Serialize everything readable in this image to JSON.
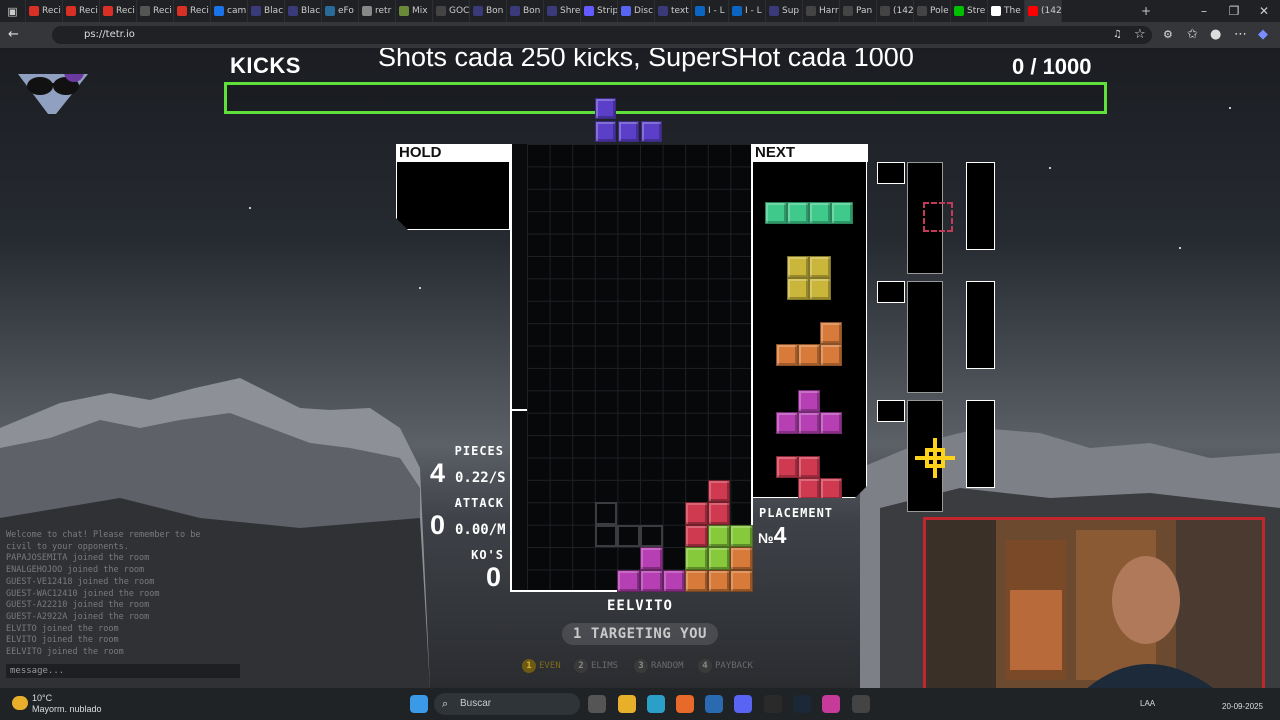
{
  "browser": {
    "tabs": [
      {
        "label": "Reci",
        "color": "#d93025"
      },
      {
        "label": "Reci",
        "color": "#d93025"
      },
      {
        "label": "Reci",
        "color": "#d93025"
      },
      {
        "label": "Reci",
        "color": "#555555"
      },
      {
        "label": "Reci",
        "color": "#d93025"
      },
      {
        "label": "cam",
        "color": "#1a73e8"
      },
      {
        "label": "Blac",
        "color": "#3a3a7a"
      },
      {
        "label": "Blac",
        "color": "#3a3a7a"
      },
      {
        "label": "eFo",
        "color": "#2a6a9a"
      },
      {
        "label": "retr",
        "color": "#888888"
      },
      {
        "label": "Mix",
        "color": "#6a8a3a"
      },
      {
        "label": "GOC",
        "color": "#444444"
      },
      {
        "label": "Bon",
        "color": "#3a3a7a"
      },
      {
        "label": "Bon",
        "color": "#3a3a7a"
      },
      {
        "label": "Shre",
        "color": "#3a3a7a"
      },
      {
        "label": "Strip",
        "color": "#635bff"
      },
      {
        "label": "Disc",
        "color": "#5865f2"
      },
      {
        "label": "text",
        "color": "#3a3a7a"
      },
      {
        "label": "I - L",
        "color": "#0a66c2"
      },
      {
        "label": "I - L",
        "color": "#0a66c2"
      },
      {
        "label": "Sup",
        "color": "#3a3a7a"
      },
      {
        "label": "Harr",
        "color": "#444444"
      },
      {
        "label": "Pan",
        "color": "#444444"
      },
      {
        "label": "(142",
        "color": "#444444"
      },
      {
        "label": "Pole",
        "color": "#444444"
      },
      {
        "label": "Stre",
        "color": "#00c000"
      },
      {
        "label": "The",
        "color": "#ffffff"
      },
      {
        "label": "(142",
        "color": "#ff0000"
      }
    ],
    "url": "ps://tetr.io"
  },
  "hud": {
    "kicks_label": "KICKS",
    "goal_text": "Shots cada 250 kicks, SuperSHot cada 1000",
    "counter": "0  / 1000",
    "progress_fraction": 0,
    "bar_color": "#5fe03a"
  },
  "panels": {
    "hold_title": "HOLD",
    "next_title": "NEXT",
    "next_queue": [
      "I",
      "O",
      "L",
      "T",
      "Z"
    ]
  },
  "piece_colors": {
    "I": "#3fc98b",
    "O": "#c9b63a",
    "L": "#d87b3a",
    "T": "#b63fb3",
    "Z": "#cf3a50",
    "S": "#86c93a",
    "J": "#5b3fc9"
  },
  "stats": {
    "pieces_label": "PIECES",
    "pieces_value": "4",
    "pieces_rate": "0.22/S",
    "attack_label": "ATTACK",
    "attack_value": "0",
    "attack_rate": "0.00/M",
    "kos_label": "KO'S",
    "kos_value": "0",
    "placement_label": "PLACEMENT",
    "placement_prefix": "№",
    "placement_value": "4"
  },
  "player": {
    "name": "EELVITO",
    "targeting": "1 TARGETING YOU"
  },
  "strategies": [
    {
      "num": "1",
      "label": "EVEN",
      "active": true
    },
    {
      "num": "2",
      "label": "ELIMS",
      "active": false
    },
    {
      "num": "3",
      "label": "RANDOM",
      "active": false
    },
    {
      "num": "4",
      "label": "PAYBACK",
      "active": false
    }
  ],
  "chat": {
    "lines": [
      "Welcome to chat! Please remember to be",
      "civil to your opponents.",
      "PAPAJOSEMITA joined the room",
      "ENALGEHOJOO joined the room",
      "GUEST-VE12418 joined the room",
      "GUEST-WAC12410 joined the room",
      "GUEST-A22210 joined the room",
      "GUEST-A2922A joined the room",
      "ELVITO joined the room",
      "ELVITO joined the room",
      "EELVITO joined the room"
    ],
    "placeholder": "message..."
  },
  "taskbar": {
    "weather_temp": "10°C",
    "weather_desc": "Mayorm. nublado",
    "search_placeholder": "Buscar",
    "lang": "LAA",
    "date": "20-09-2025"
  }
}
